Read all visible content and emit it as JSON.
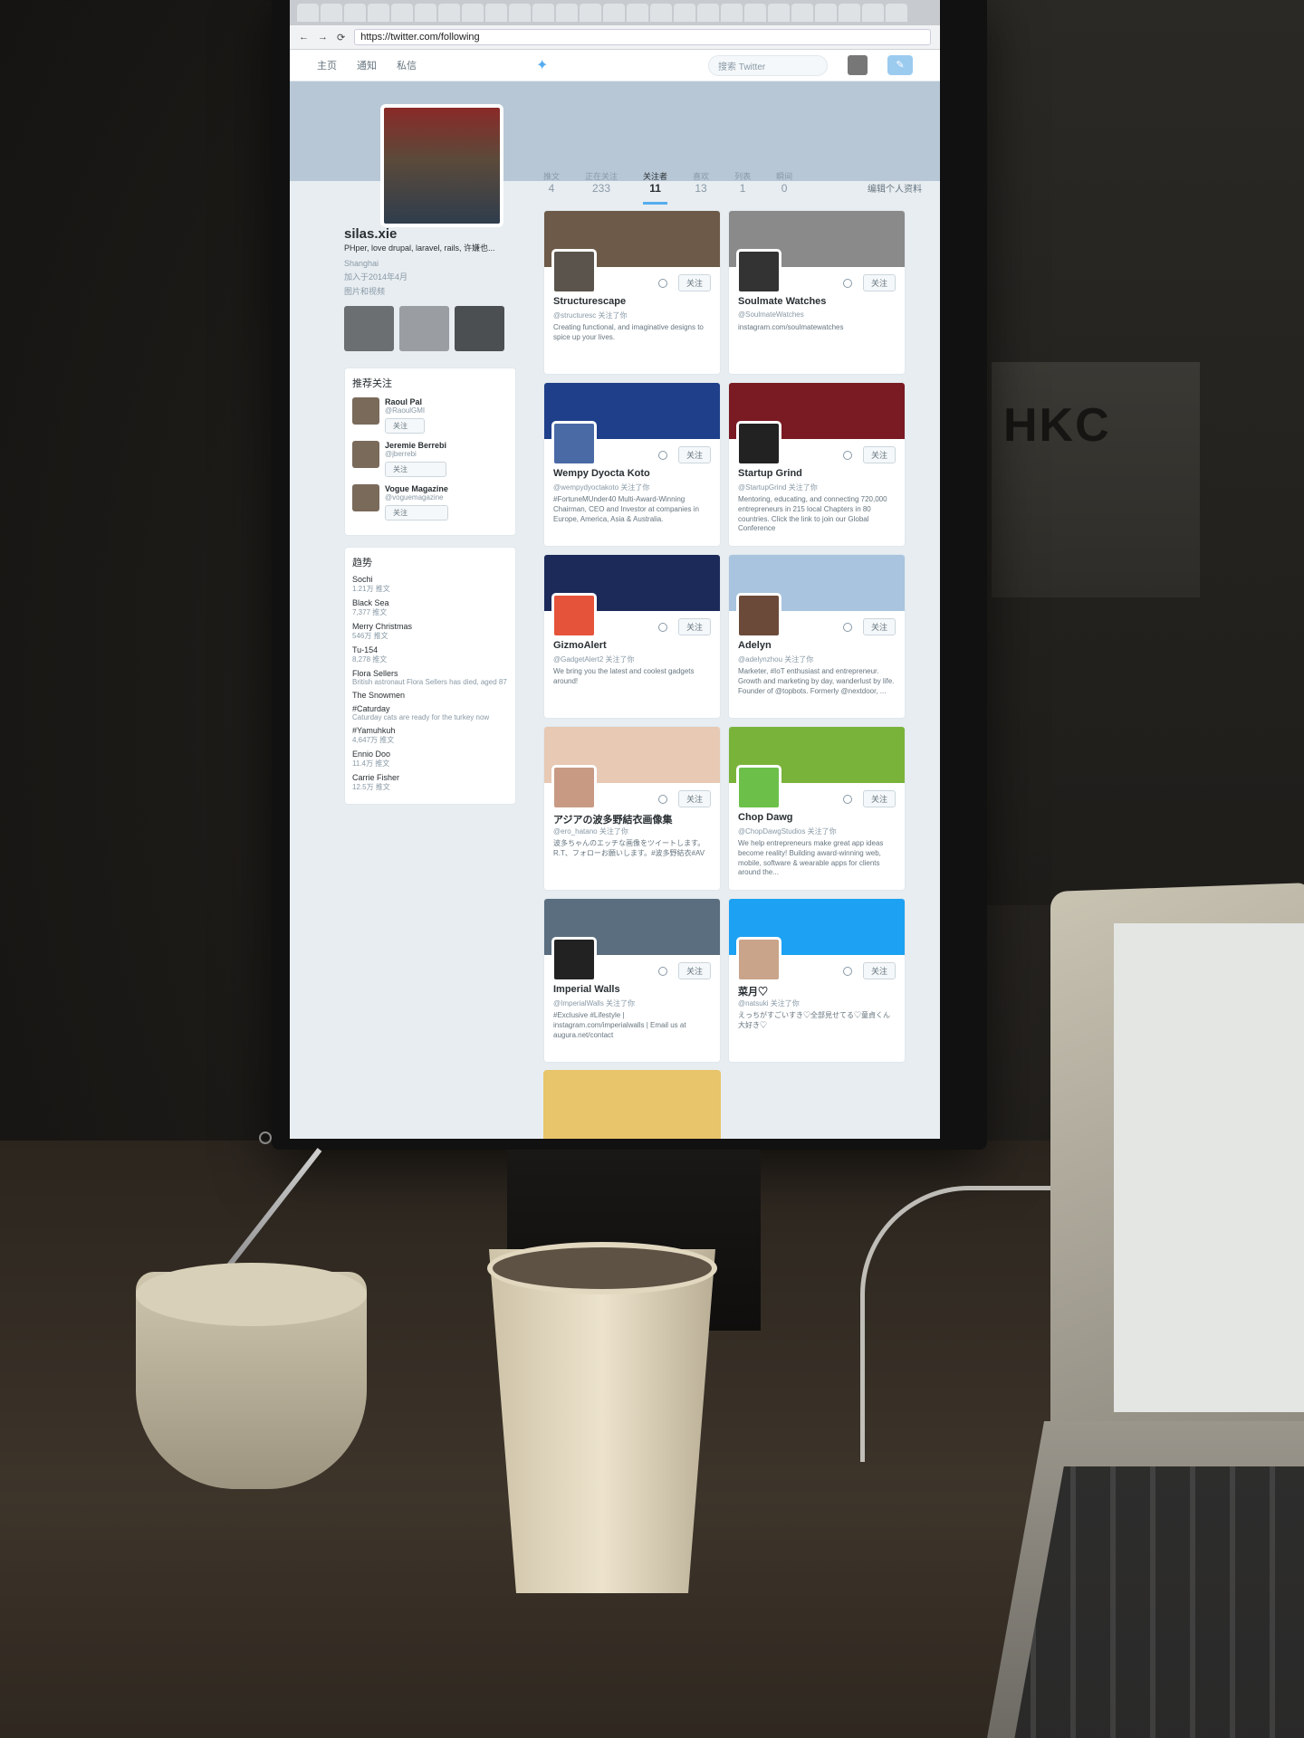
{
  "browser": {
    "url": "https://twitter.com/following"
  },
  "nav": {
    "home": "主页",
    "notifications": "通知",
    "messages": "私信",
    "search_placeholder": "搜索 Twitter",
    "bird_icon": "twitter-bird-icon"
  },
  "profile": {
    "name": "silas.xie",
    "bio": "PHper, love drupal, laravel, rails, 许嫌也...",
    "location": "Shanghai",
    "joined": "加入于2014年4月",
    "media_label": "图片和视频",
    "edit_label": "编辑个人资料"
  },
  "stats": [
    {
      "label": "推文",
      "value": "4"
    },
    {
      "label": "正在关注",
      "value": "233"
    },
    {
      "label": "关注者",
      "value": "11"
    },
    {
      "label": "喜欢",
      "value": "13"
    },
    {
      "label": "列表",
      "value": "1"
    },
    {
      "label": "瞬间",
      "value": "0"
    }
  ],
  "who_to_follow": {
    "title": "推荐关注",
    "follow_label": "关注",
    "items": [
      {
        "name": "Raoul Pal",
        "handle": "@RaoulGMI"
      },
      {
        "name": "Jeremie Berrebi",
        "handle": "@jberrebi"
      },
      {
        "name": "Vogue Magazine",
        "handle": "@voguemagazine"
      }
    ]
  },
  "trends": {
    "title": "趋势",
    "items": [
      {
        "name": "Sochi",
        "count": "1.21万 推文"
      },
      {
        "name": "Black Sea",
        "count": "7,377 推文"
      },
      {
        "name": "Merry Christmas",
        "count": "546万 推文"
      },
      {
        "name": "Tu-154",
        "count": "8,278 推文"
      },
      {
        "name": "Flora Sellers",
        "count": "British astronaut Flora Sellers has died, aged 87"
      },
      {
        "name": "The Snowmen",
        "count": ""
      },
      {
        "name": "#Caturday",
        "count": "Caturday cats are ready for the turkey now"
      },
      {
        "name": "#Yamuhkuh",
        "count": "4,647万 推文"
      },
      {
        "name": "Ennio Doo",
        "count": "11.4万 推文"
      },
      {
        "name": "Carrie Fisher",
        "count": "12.5万 推文"
      }
    ]
  },
  "cards": [
    {
      "name": "Structurescape",
      "handle": "@structuresc 关注了你",
      "bio": "Creating functional, and imaginative designs to spice up your lives.",
      "banner": "#6d5a48",
      "avatar": "#5a544c"
    },
    {
      "name": "Soulmate Watches",
      "handle": "@SoulmateWatches",
      "bio": "instagram.com/soulmatewatches",
      "banner": "#8a8a8a",
      "avatar": "#333333"
    },
    {
      "name": "Wempy Dyocta Koto",
      "handle": "@wempydyoctakoto 关注了你",
      "bio": "#FortuneMUnder40 Multi-Award-Winning Chairman, CEO and Investor at companies in Europe, America, Asia & Australia.",
      "banner": "#1f3f8a",
      "avatar": "#4a6aa6"
    },
    {
      "name": "Startup Grind",
      "handle": "@StartupGrind 关注了你",
      "bio": "Mentoring, educating, and connecting 720,000 entrepreneurs in 215 local Chapters in 80 countries. Click the link to join our Global Conference",
      "banner": "#7a1a22",
      "avatar": "#222222"
    },
    {
      "name": "GizmoAlert",
      "handle": "@GadgetAlert2 关注了你",
      "bio": "We bring you the latest and coolest gadgets around!",
      "banner": "#1c2a5a",
      "avatar": "#e5543a"
    },
    {
      "name": "Adelyn",
      "handle": "@adelynzhou 关注了你",
      "bio": "Marketer, #IoT enthusiast and entrepreneur. Growth and marketing by day, wanderlust by life. Founder of @topbots. Formerly @nextdoor, ...",
      "banner": "#a9c4de",
      "avatar": "#6b4a3a"
    },
    {
      "name": "アジアの波多野結衣画像集",
      "handle": "@ero_hatano 关注了你",
      "bio": "波多ちゃんのエッチな画像をツイートします。R.T、フォローお願いします。#波多野結衣#AV",
      "banner": "#e7c9b4",
      "avatar": "#c89a84"
    },
    {
      "name": "Chop Dawg",
      "handle": "@ChopDawgStudios 关注了你",
      "bio": "We help entrepreneurs make great app ideas become reality! Building award-winning web, mobile, software & wearable apps for clients around the...",
      "banner": "#7ab33a",
      "avatar": "#6cc04a"
    },
    {
      "name": "Imperial Walls",
      "handle": "@ImperialWalls 关注了你",
      "bio": "#Exclusive #Lifestyle | instagram.com/imperialwalls | Email us at augura.net/contact",
      "banner": "#5a6e80",
      "avatar": "#222222"
    },
    {
      "name": "菜月♡",
      "handle": "@natsuki 关注了你",
      "bio": "えっちがすごいすき♡全部見せてる♡童貞くん大好き♡",
      "banner": "#1da1f2",
      "avatar": "#c9a48a"
    }
  ],
  "card_actions": {
    "follow_label": "关注",
    "gear_icon": "gear-icon"
  },
  "room": {
    "brand_text": "HKC"
  },
  "colors": {
    "twitter_blue": "#55acee",
    "banner": "#b7c7d6"
  }
}
